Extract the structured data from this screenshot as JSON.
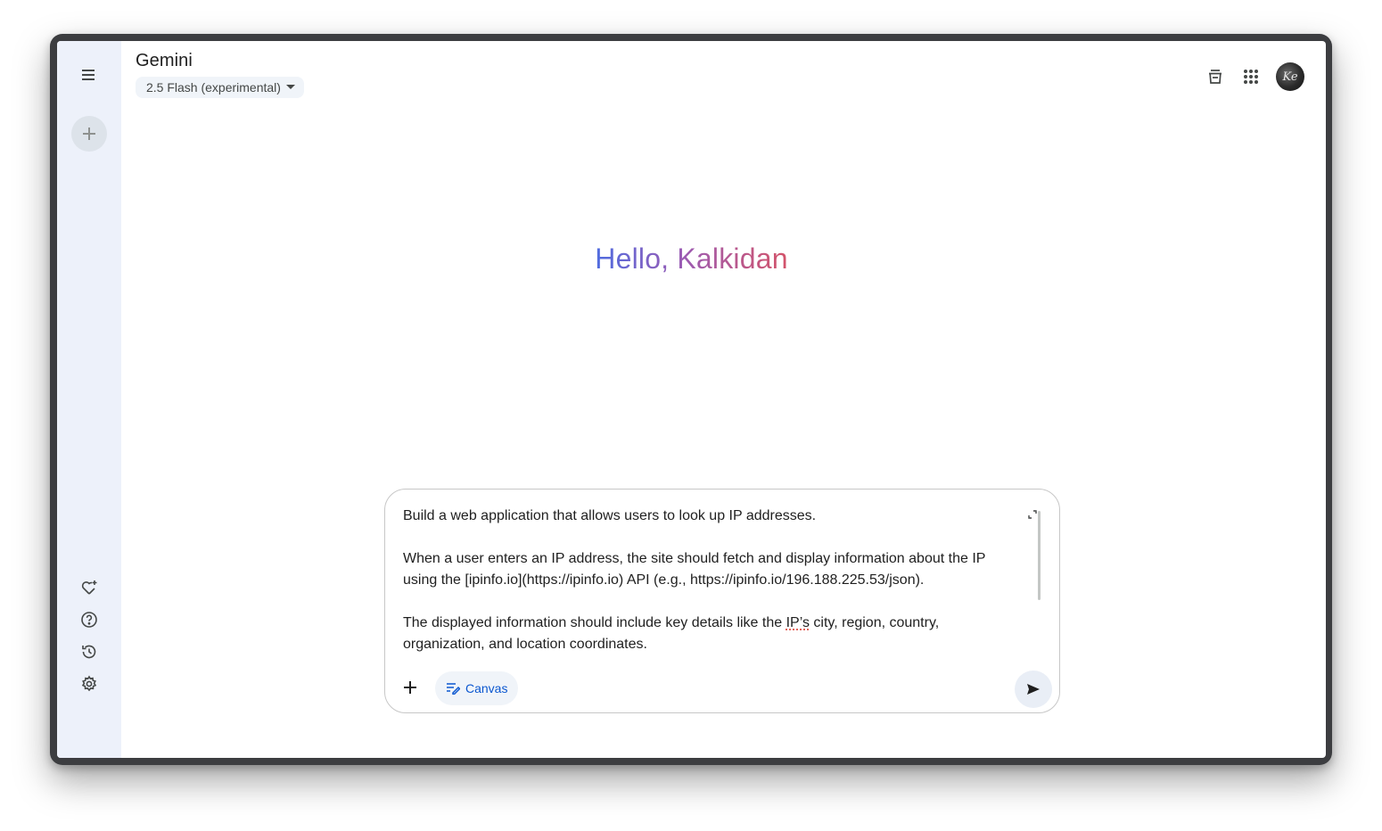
{
  "app": {
    "title": "Gemini",
    "model_label": "2.5 Flash (experimental)"
  },
  "sidebar": {
    "icons": [
      "menu-icon",
      "plus-icon",
      "gem-icon",
      "help-icon",
      "history-icon",
      "gear-icon"
    ]
  },
  "header": {
    "icons": [
      "temporary-chat-icon",
      "apps-grid-icon"
    ],
    "avatar_initials": "Ke"
  },
  "greeting": "Hello, Kalkidan",
  "composer": {
    "line1": "Build a web application that allows users to look up IP addresses.",
    "line2": "When a user enters an IP address, the site should fetch and display information about the IP using the [ipinfo.io](https://ipinfo.io) API (e.g., https://ipinfo.io/196.188.225.53/json).",
    "line3_pre": "The displayed information should include key details like the ",
    "line3_flag": "IP’s",
    "line3_post": " city, region, country, organization, and location coordinates.",
    "canvas_label": "Canvas"
  },
  "colors": {
    "sidebar_bg": "#edf1fa",
    "accent": "#0b57d0",
    "greeting_start": "#4f6ce0",
    "greeting_end": "#d4546a"
  }
}
